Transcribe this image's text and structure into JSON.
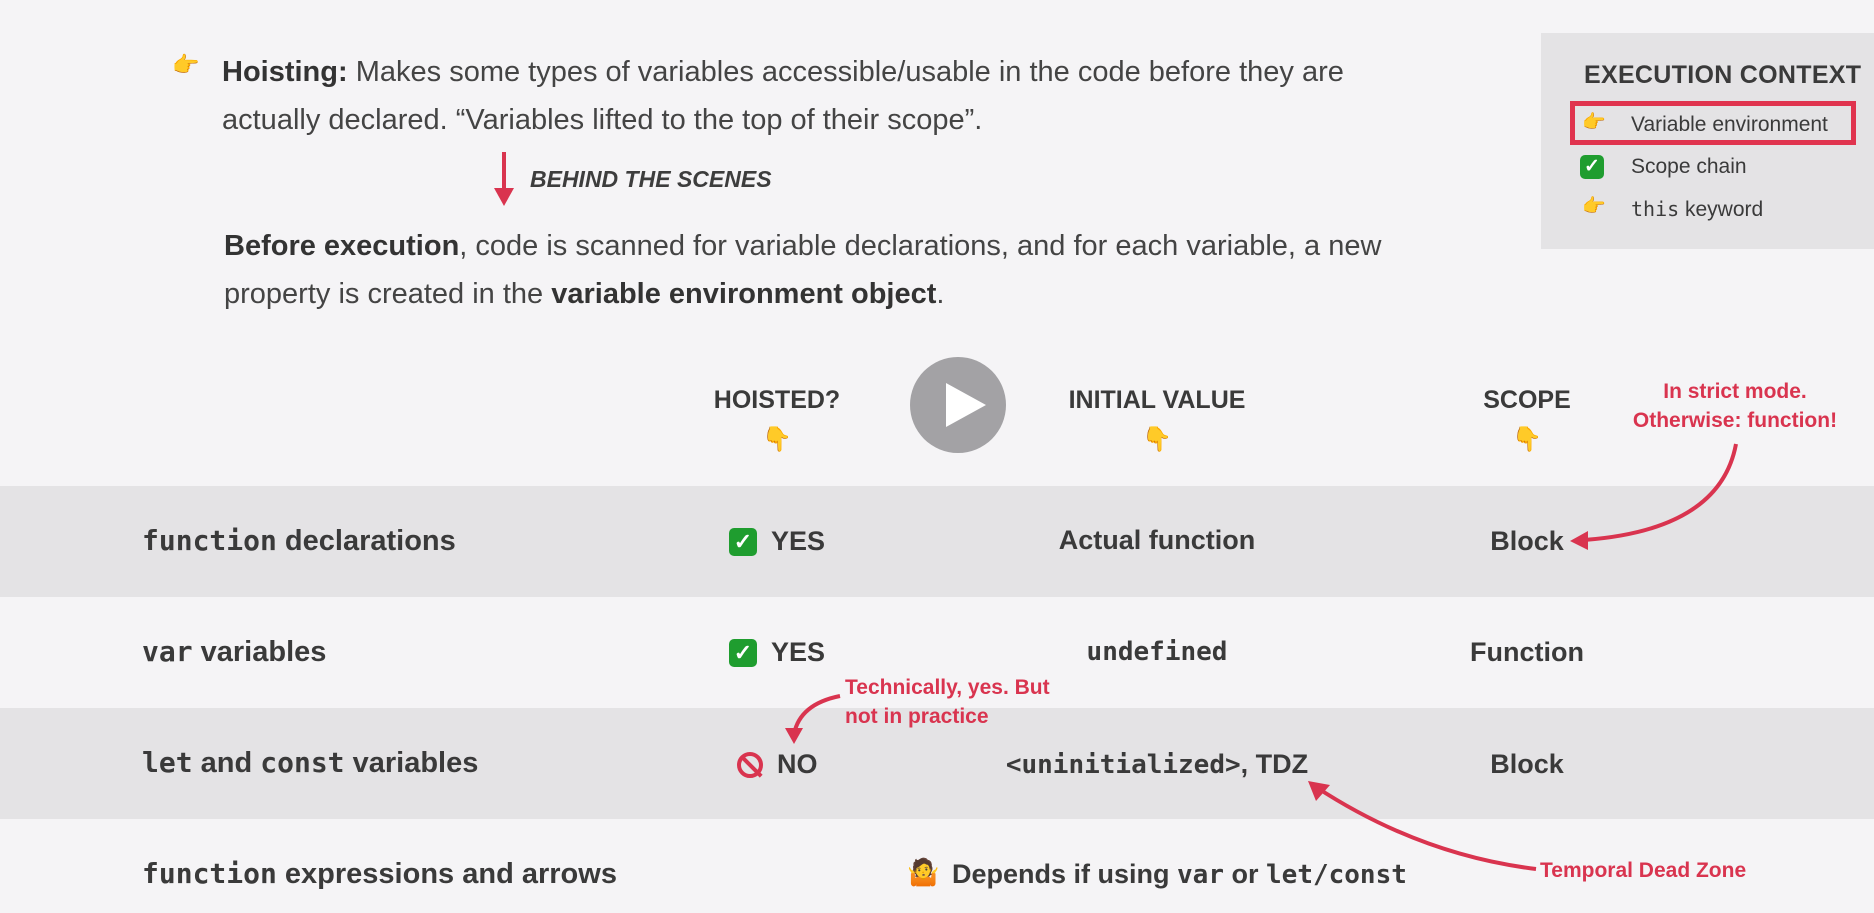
{
  "hoisting": {
    "term": "Hoisting:",
    "text": "Makes some types of variables accessible/usable in the code before they are actually declared. “Variables lifted to the top of their scope”."
  },
  "behind_the_scenes": "BEHIND THE SCENES",
  "before": {
    "bold_start": "Before execution",
    "middle": ", code is scanned for variable declarations, and for each variable, a new property is created in the ",
    "bold_end": "variable environment object",
    "end": "."
  },
  "execution_context": {
    "title": "EXECUTION CONTEXT",
    "items": [
      {
        "label": "Variable environment",
        "icon": "pointing-right-icon",
        "highlighted": true
      },
      {
        "label": "Scope chain",
        "icon": "check-mark-icon"
      },
      {
        "code": "this",
        "label": " keyword",
        "icon": "pointing-right-icon"
      }
    ]
  },
  "columns": {
    "hoisted": "HOISTED?",
    "initial_value": "INITIAL VALUE",
    "scope": "SCOPE"
  },
  "rows": [
    {
      "label_code": "function",
      "label_text": " declarations",
      "hoisted": "YES",
      "hoisted_icon": "check-mark-icon",
      "initial_value": "Actual function",
      "scope": "Block"
    },
    {
      "label_code": "var",
      "label_text": " variables",
      "hoisted": "YES",
      "hoisted_icon": "check-mark-icon",
      "initial_value_code": "undefined",
      "scope": "Function"
    },
    {
      "label_code": "let",
      "label_mid": " and ",
      "label_code2": "const",
      "label_text": " variables",
      "hoisted": "NO",
      "hoisted_icon": "prohibited-icon",
      "initial_value_code": "<uninitialized>",
      "initial_value_text": ", TDZ",
      "scope": "Block"
    },
    {
      "label_code": "function",
      "label_text": " expressions and arrows",
      "depends_text": "Depends if using ",
      "depends_code1": "var",
      "depends_or": " or ",
      "depends_code2": "let/const"
    }
  ],
  "notes": {
    "strict_mode": [
      "In strict mode.",
      "Otherwise: function!"
    ],
    "technically": [
      "Technically, yes. But",
      "not in practice"
    ],
    "tdz": "Temporal Dead Zone"
  },
  "colors": {
    "accent": "#d9344f",
    "row_band": "#e4e3e5",
    "background": "#f5f4f6"
  }
}
